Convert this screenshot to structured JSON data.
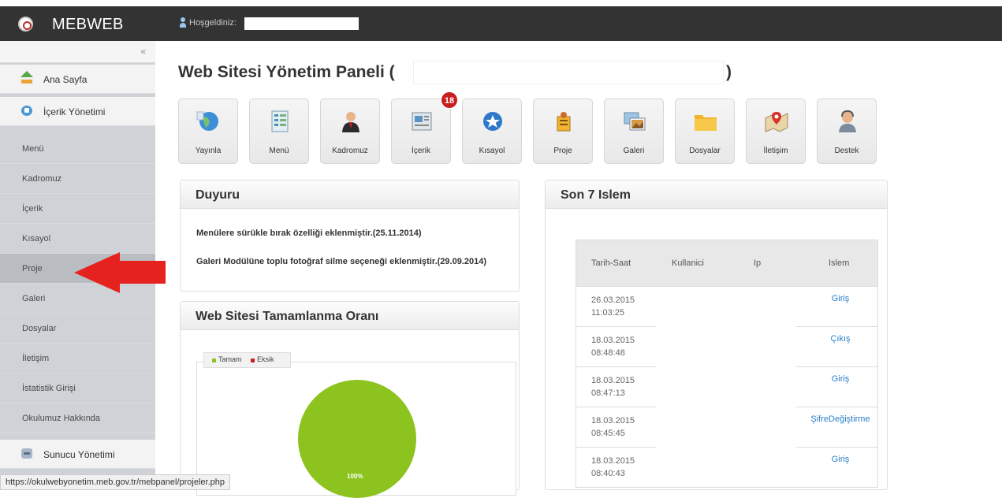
{
  "topbar": {
    "brand": "MEBWEB",
    "welcome": "Hoşgeldiniz:"
  },
  "sidebar": {
    "collapse": "«",
    "main_items": [
      {
        "label": "Ana Sayfa",
        "icon": "home-icon"
      },
      {
        "label": "İçerik Yönetimi",
        "icon": "content-icon"
      }
    ],
    "sub_items": [
      {
        "label": "Menü"
      },
      {
        "label": "Kadromuz"
      },
      {
        "label": "İçerik"
      },
      {
        "label": "Kısayol"
      },
      {
        "label": "Proje"
      },
      {
        "label": "Galeri"
      },
      {
        "label": "Dosyalar"
      },
      {
        "label": "İletişim"
      },
      {
        "label": "İstatistik Girişi"
      },
      {
        "label": "Okulumuz Hakkında"
      }
    ],
    "server_item": {
      "label": "Sunucu Yönetimi",
      "icon": "server-icon"
    }
  },
  "main": {
    "title": "Web Sitesi Yönetim Paneli (",
    "title_close": ")",
    "tiles": [
      {
        "label": "Yayınla",
        "icon": "globe-icon"
      },
      {
        "label": "Menü",
        "icon": "menu-list-icon"
      },
      {
        "label": "Kadromuz",
        "icon": "staff-person-icon"
      },
      {
        "label": "İçerik",
        "icon": "content-document-icon"
      },
      {
        "label": "Kısayol",
        "icon": "star-shortcut-icon"
      },
      {
        "label": "Proje",
        "icon": "project-icon"
      },
      {
        "label": "Galeri",
        "icon": "gallery-photo-icon"
      },
      {
        "label": "Dosyalar",
        "icon": "folder-icon"
      },
      {
        "label": "İletişim",
        "icon": "map-pin-icon"
      },
      {
        "label": "Destek",
        "icon": "support-agent-icon"
      }
    ],
    "badge": "18",
    "duyuru": {
      "title": "Duyuru",
      "items": [
        "Menülere sürükle bırak özelliği eklenmiştir.(25.11.2014)",
        "Galeri Modülüne toplu fotoğraf silme seçeneği eklenmiştir.(29.09.2014)"
      ]
    },
    "completion": {
      "title": "Web Sitesi Tamamlanma Oranı",
      "legend": [
        "Tamam",
        "Eksik"
      ],
      "pie_label": "100%"
    },
    "log": {
      "title": "Son 7 Islem",
      "headers": [
        "Tarih-Saat",
        "Kullanici",
        "Ip",
        "Islem"
      ],
      "rows": [
        {
          "date": "26.03.2015",
          "time": "11:03:25",
          "action": "Giriş"
        },
        {
          "date": "18.03.2015",
          "time": "08:48:48",
          "action": "Çıkış"
        },
        {
          "date": "18.03.2015",
          "time": "08:47:13",
          "action": "Giriş"
        },
        {
          "date": "18.03.2015",
          "time": "08:45:45",
          "action": "ŞifreDeğiştirme"
        },
        {
          "date": "18.03.2015",
          "time": "08:40:43",
          "action": "Giriş"
        }
      ]
    }
  },
  "colors": {
    "tamam": "#8dc31e",
    "eksik": "#c81e1e",
    "arrow": "#e6221f",
    "link": "#2a80c8"
  },
  "status_url": "https://okulwebyonetim.meb.gov.tr/mebpanel/projeler.php"
}
